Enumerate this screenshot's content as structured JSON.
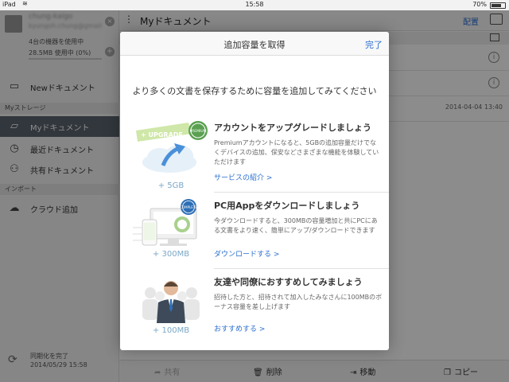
{
  "status_bar": {
    "device": "iPad",
    "time": "15:58",
    "battery": "70%"
  },
  "sidebar": {
    "account_name": "chung-kaigo",
    "account_email": "kyungoh.chung@gmail",
    "devices": "4台の機器を使用中",
    "usage": "28.5MB 使用中 (0%)",
    "new_doc": "Newドキュメント",
    "storage_header": "Myストレージ",
    "items": [
      {
        "label": "Myドキュメント"
      },
      {
        "label": "最近ドキュメント"
      },
      {
        "label": "共有ドキュメント"
      }
    ],
    "import_header": "インポート",
    "cloud_add": "クラウド追加",
    "sync_status": "同期化を完了",
    "sync_time": "2014/05/29 15:58"
  },
  "main": {
    "title": "Myドキュメント",
    "arrange_label": "配置",
    "file_date": "2014-04-04 13:40"
  },
  "toolbar": {
    "share": "共有",
    "delete": "削除",
    "move": "移動",
    "copy": "コピー"
  },
  "modal": {
    "title": "追加容量を取得",
    "done": "完了",
    "intro": "より多くの文書を保存するために容量を追加してみてください",
    "sections": [
      {
        "title": "アカウントをアップグレードしましょう",
        "desc": "Premiumアカウントになると、5GBの追加容量だけでなくデバイスの追加、保安などさまざまな機能を体験していただけます",
        "link": "サービスの紹介 >",
        "amount": "+ 5GB",
        "badge": "+ UPGRADE",
        "seal": "PREMIUM"
      },
      {
        "title": "PC用Appをダウンロードしましょう",
        "desc": "今ダウンロードすると、300MBの容量増加と共にPCにある文書をより速く、簡単にアップ/ダウンロードできます",
        "link": "ダウンロードする >",
        "amount": "+ 300MB",
        "seal": "COMPLETE"
      },
      {
        "title": "友達や同僚におすすめしてみましょう",
        "desc": "招待した方と、招待されて加入したみなさんに100MBのボーナス容量を差し上げます",
        "link": "おすすめする >",
        "amount": "+ 100MB"
      }
    ]
  },
  "colors": {
    "accent": "#2a6ecf",
    "active_row": "#5b6470",
    "amount": "#7aa7c7"
  }
}
